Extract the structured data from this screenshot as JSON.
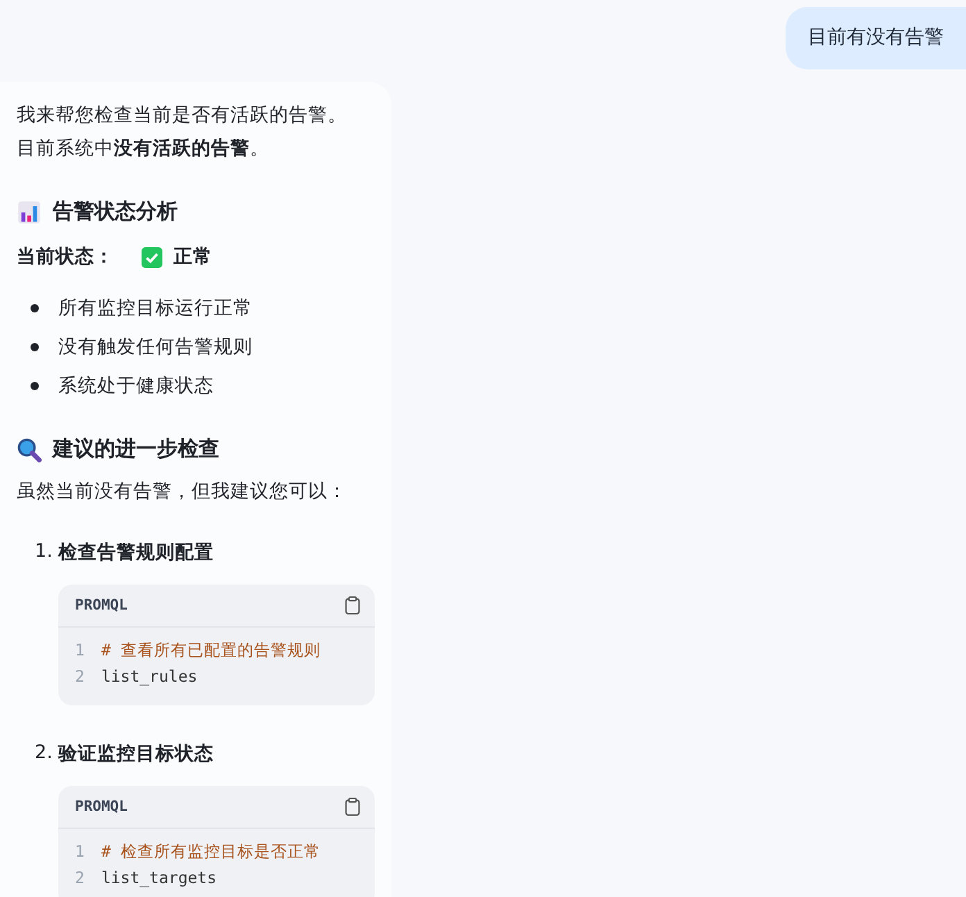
{
  "user_message": "目前有没有告警",
  "intro": [
    "我来帮您检查当前是否有活跃的告警。",
    "目前系统中**没有活跃的告警**。"
  ],
  "analysis": {
    "heading": "告警状态分析",
    "status_label": "当前状态：",
    "status_ok": true,
    "status_value": "正常",
    "bullets": [
      "所有监控目标运行正常",
      "没有触发任何告警规则",
      "系统处于健康状态"
    ]
  },
  "suggestions": {
    "heading": "建议的进一步检查",
    "lead": "虽然当前没有告警，但我建议您可以：",
    "steps": [
      {
        "number": "1.",
        "title": "检查告警规则配置",
        "code": {
          "language": "PROMQL",
          "lines": [
            {
              "number": "1",
              "text": "# 查看所有已配置的告警规则",
              "kind": "comment"
            },
            {
              "number": "2",
              "text": "list_rules",
              "kind": "code"
            }
          ]
        }
      },
      {
        "number": "2.",
        "title": "验证监控目标状态",
        "code": {
          "language": "PROMQL",
          "lines": [
            {
              "number": "1",
              "text": "# 检查所有监控目标是否正常",
              "kind": "comment"
            },
            {
              "number": "2",
              "text": "list_targets",
              "kind": "code"
            }
          ]
        }
      }
    ]
  }
}
